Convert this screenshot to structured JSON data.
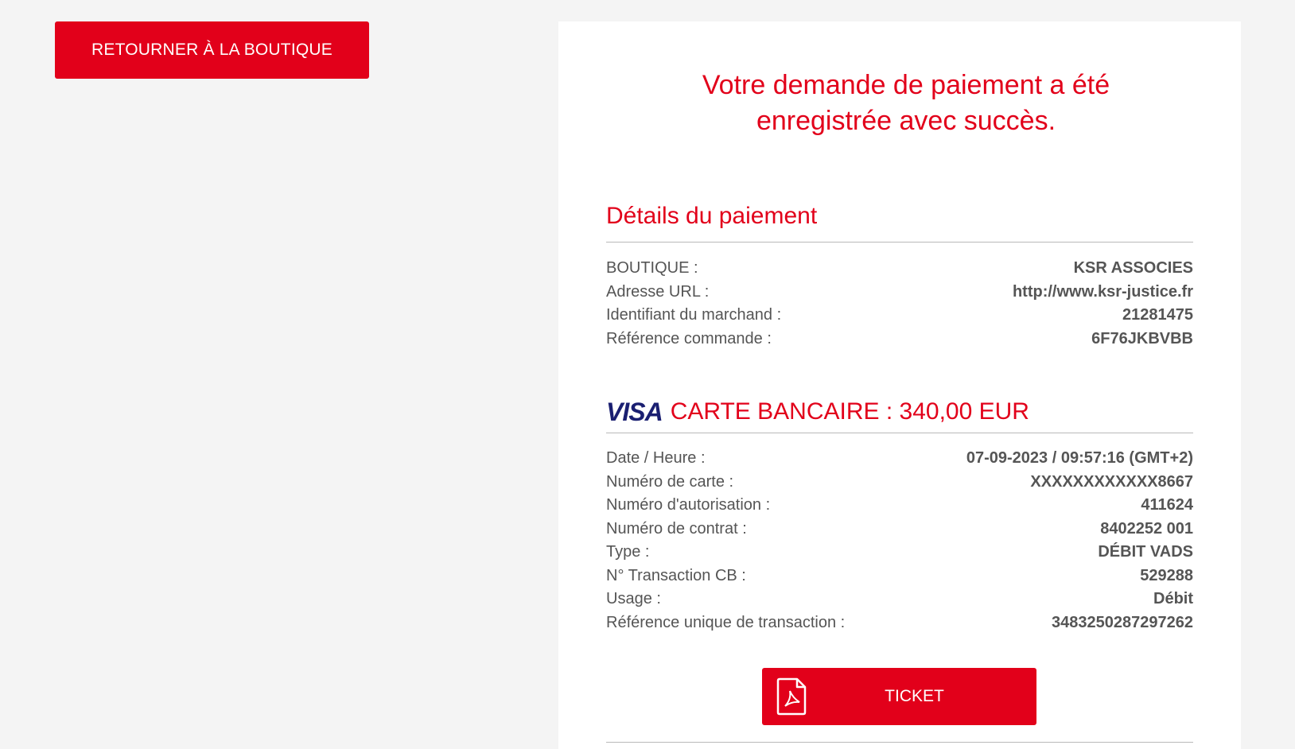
{
  "back_button": {
    "label": "RETOURNER À LA BOUTIQUE"
  },
  "confirmation": {
    "line1": "Votre demande de paiement a été",
    "line2": "enregistrée avec succès."
  },
  "payment_details": {
    "title": "Détails du paiement",
    "rows": [
      {
        "label": "BOUTIQUE :",
        "value": "KSR ASSOCIES"
      },
      {
        "label": "Adresse URL :",
        "value": "http://www.ksr-justice.fr"
      },
      {
        "label": "Identifiant du marchand :",
        "value": "21281475"
      },
      {
        "label": "Référence commande :",
        "value": "6F76JKBVBB"
      }
    ]
  },
  "card_payment": {
    "brand_logo": "VISA",
    "title": "CARTE BANCAIRE : 340,00 EUR",
    "rows": [
      {
        "label": "Date / Heure :",
        "value": "07-09-2023 / 09:57:16 (GMT+2)"
      },
      {
        "label": "Numéro de carte :",
        "value": "XXXXXXXXXXXX8667"
      },
      {
        "label": "Numéro d'autorisation :",
        "value": "411624"
      },
      {
        "label": "Numéro de contrat :",
        "value": "8402252 001"
      },
      {
        "label": "Type :",
        "value": "DÉBIT VADS"
      },
      {
        "label": "N° Transaction CB :",
        "value": "529288"
      },
      {
        "label": "Usage :",
        "value": "Débit"
      },
      {
        "label": "Référence unique de transaction :",
        "value": "3483250287297262"
      }
    ]
  },
  "ticket_button": {
    "label": "TICKET",
    "icon": "pdf-file-icon"
  },
  "colors": {
    "accent": "#e2001a",
    "visa_blue": "#1a1f71",
    "text": "#555555",
    "background": "#f4f4f4"
  }
}
